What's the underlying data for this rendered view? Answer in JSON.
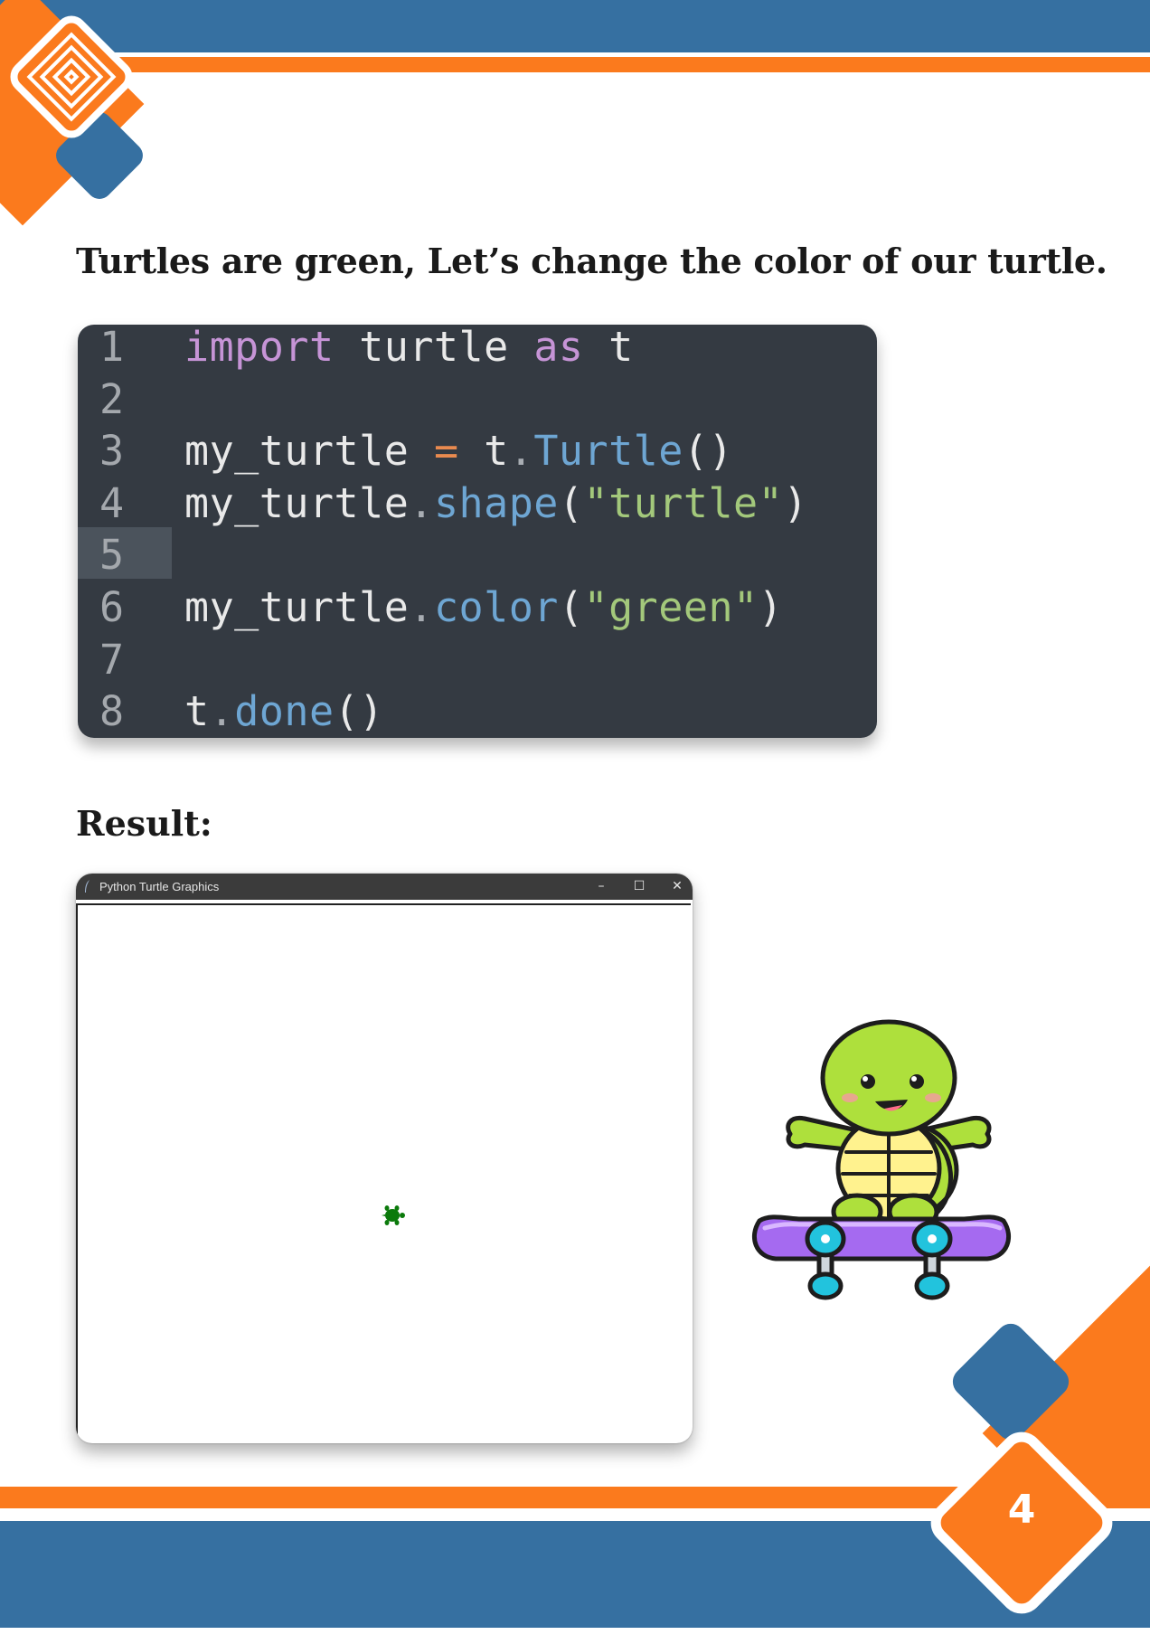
{
  "heading": "Turtles are green, Let’s change the color of our turtle.",
  "code_lines": [
    {
      "num": "1",
      "tokens": [
        {
          "t": "import",
          "c": "kw"
        },
        {
          "t": " turtle ",
          "c": ""
        },
        {
          "t": "as",
          "c": "kw"
        },
        {
          "t": " t",
          "c": ""
        }
      ]
    },
    {
      "num": "2",
      "tokens": []
    },
    {
      "num": "3",
      "tokens": [
        {
          "t": "my_turtle ",
          "c": ""
        },
        {
          "t": "=",
          "c": "op"
        },
        {
          "t": " t",
          "c": ""
        },
        {
          "t": ".",
          "c": "dot"
        },
        {
          "t": "Turtle",
          "c": "fn"
        },
        {
          "t": "()",
          "c": ""
        }
      ]
    },
    {
      "num": "4",
      "tokens": [
        {
          "t": "my_turtle",
          "c": ""
        },
        {
          "t": ".",
          "c": "dot"
        },
        {
          "t": "shape",
          "c": "fn"
        },
        {
          "t": "(",
          "c": ""
        },
        {
          "t": "\"turtle\"",
          "c": "str"
        },
        {
          "t": ")",
          "c": ""
        }
      ]
    },
    {
      "num": "5",
      "tokens": []
    },
    {
      "num": "6",
      "tokens": [
        {
          "t": "my_turtle",
          "c": ""
        },
        {
          "t": ".",
          "c": "dot"
        },
        {
          "t": "color",
          "c": "fn"
        },
        {
          "t": "(",
          "c": ""
        },
        {
          "t": "\"green\"",
          "c": "str"
        },
        {
          "t": ")",
          "c": ""
        }
      ]
    },
    {
      "num": "7",
      "tokens": []
    },
    {
      "num": "8",
      "tokens": [
        {
          "t": "t",
          "c": ""
        },
        {
          "t": ".",
          "c": "dot"
        },
        {
          "t": "done",
          "c": "fn"
        },
        {
          "t": "()",
          "c": ""
        }
      ]
    }
  ],
  "result_label": "Result:",
  "window": {
    "title": "Python Turtle Graphics",
    "minimize_glyph": "–",
    "maximize_glyph": "☐",
    "close_glyph": "✕",
    "turtle_color": "#0b7a0b"
  },
  "page_number": "4",
  "colors": {
    "brand_blue": "#3670a1",
    "brand_orange": "#fb7a1d",
    "code_bg": "#343a42"
  }
}
